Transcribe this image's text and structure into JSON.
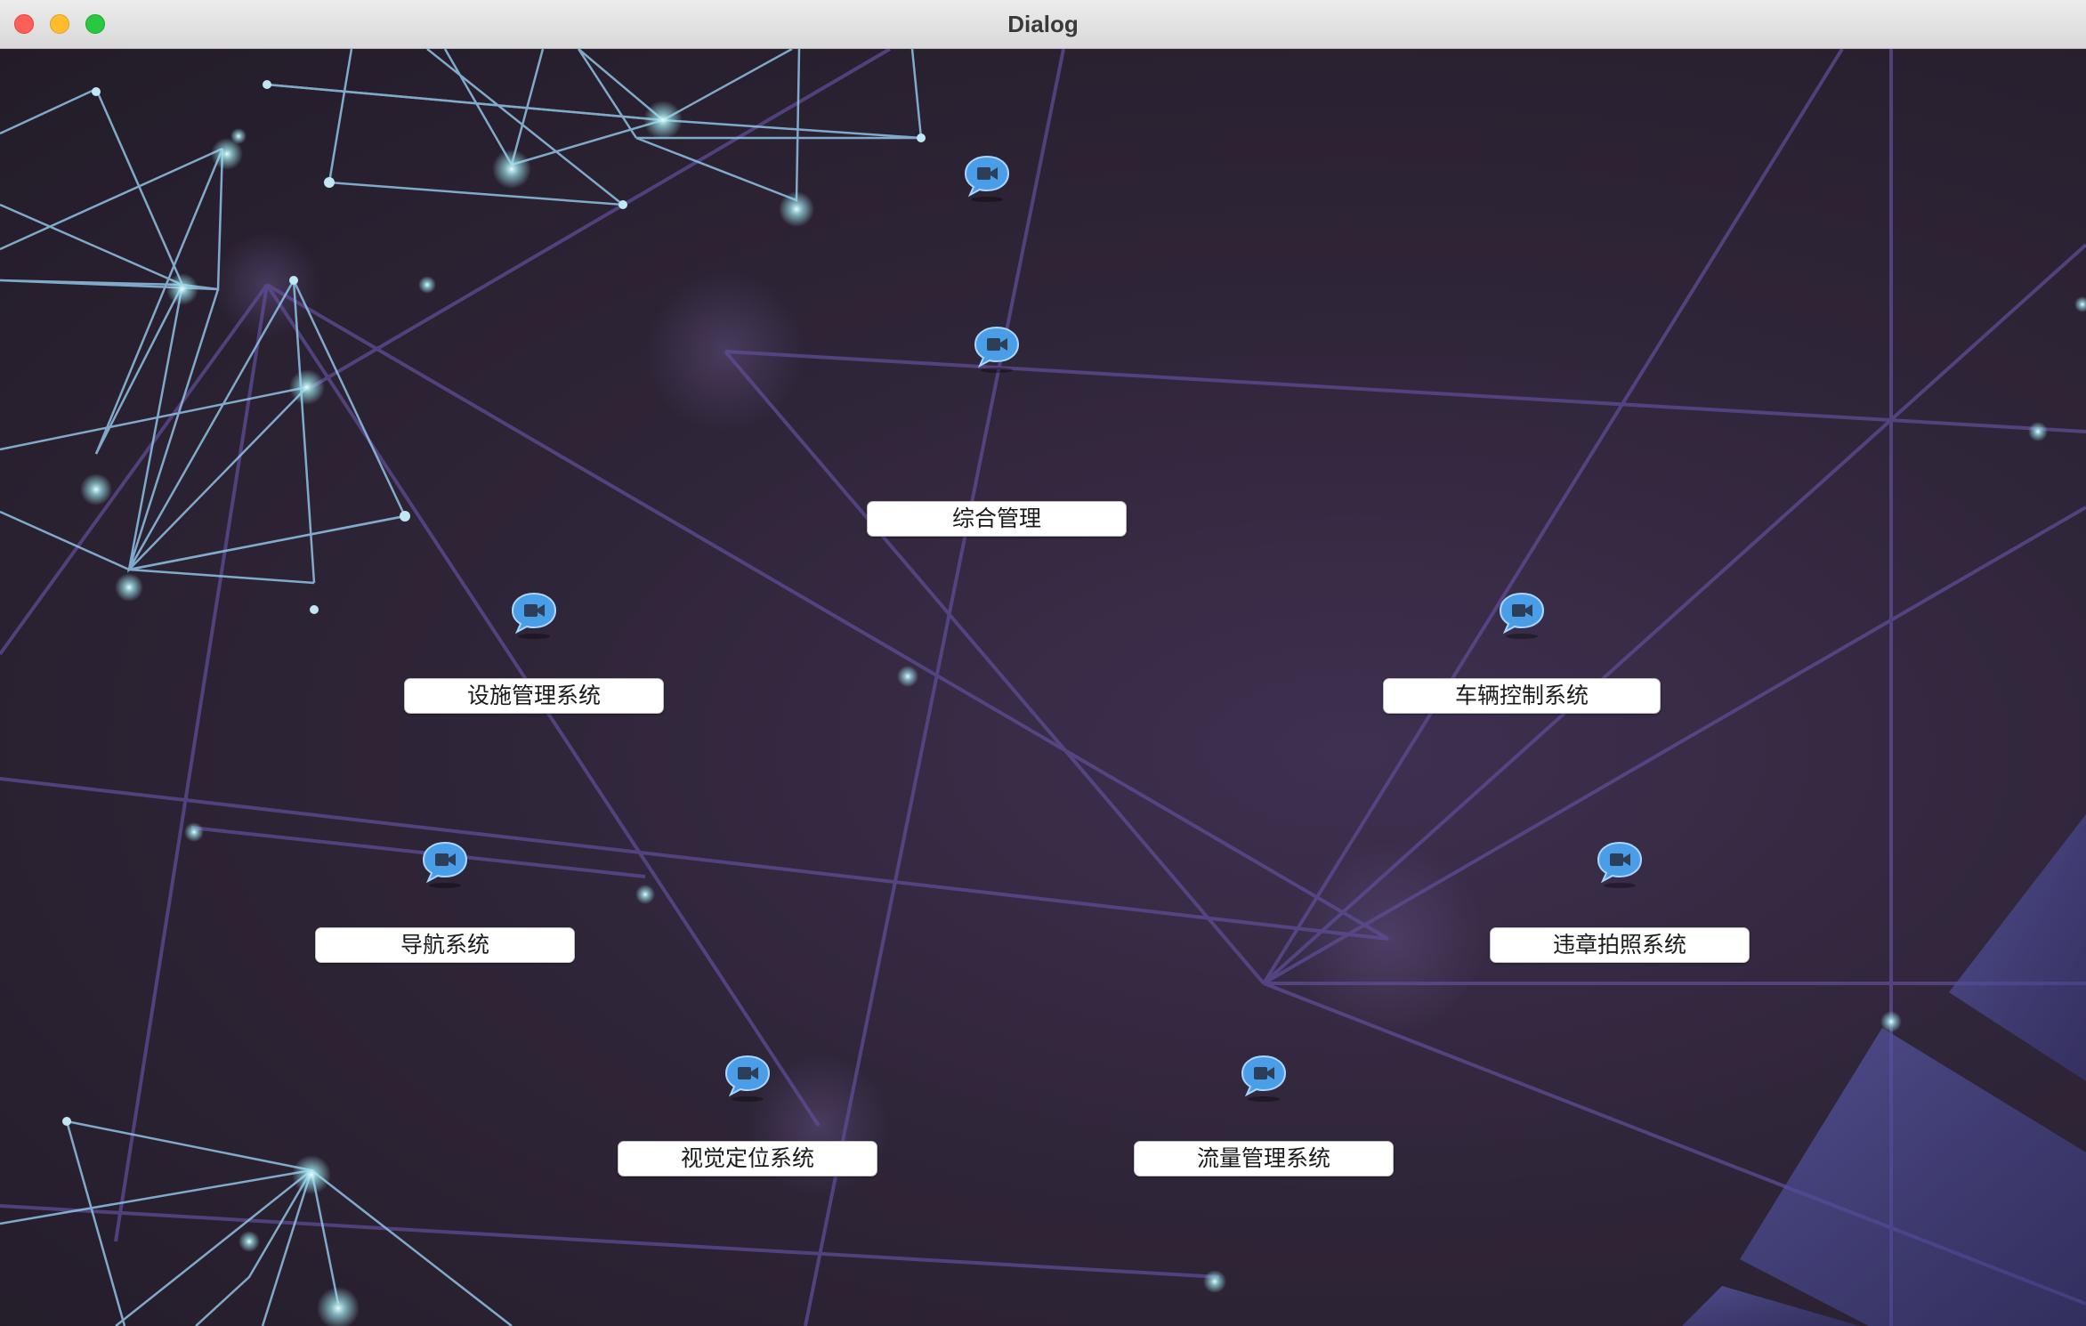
{
  "window": {
    "title": "Dialog"
  },
  "buttons": {
    "integrated": "综合管理",
    "facility": "设施管理系统",
    "vehicle": "车辆控制系统",
    "navigation": "导航系统",
    "violation": "违章拍照系统",
    "vision": "视觉定位系统",
    "traffic": "流量管理系统"
  },
  "icons": {
    "name": "video-chat-bubble-icon",
    "accent": "#4a9ee8"
  },
  "colors": {
    "background": "#2f2538",
    "network_lines": "#8fc3e6",
    "traffic_close": "#fe5f57",
    "traffic_minimize": "#febc2e",
    "traffic_maximize": "#28c840"
  }
}
